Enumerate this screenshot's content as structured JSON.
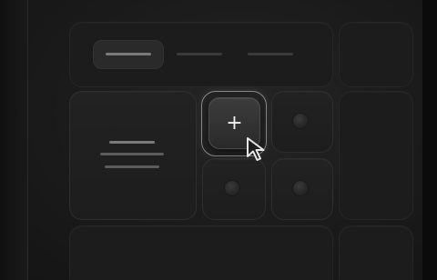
{
  "add_button": {
    "glyph": "+"
  },
  "icons": {
    "plus": "plus-icon",
    "cursor": "cursor-pointer-icon"
  },
  "colors": {
    "background": "#1c1c1c",
    "tile": "#222222",
    "accent_outline": "#8a8a8a",
    "glyph": "#f2f2f2"
  }
}
